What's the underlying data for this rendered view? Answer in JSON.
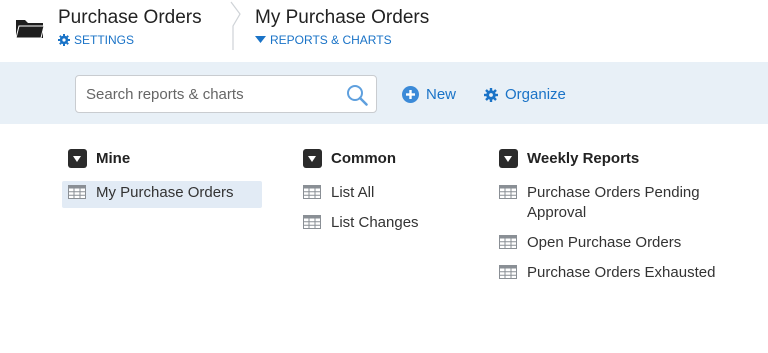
{
  "header": {
    "section_title": "Purchase Orders",
    "settings_label": "SETTINGS",
    "page_title": "My Purchase Orders",
    "reports_label": "REPORTS & CHARTS"
  },
  "toolbar": {
    "search_placeholder": "Search reports & charts",
    "new_label": "New",
    "organize_label": "Organize"
  },
  "groups": [
    {
      "title": "Mine",
      "items": [
        "My Purchase Orders"
      ],
      "selected": "My Purchase Orders"
    },
    {
      "title": "Common",
      "items": [
        "List All",
        "List Changes"
      ]
    },
    {
      "title": "Weekly Reports",
      "items": [
        "Purchase Orders Pending Approval",
        "Open Purchase Orders",
        "Purchase Orders Exhausted"
      ]
    }
  ],
  "colors": {
    "accent": "#1a73c7",
    "toolbar_bg": "#e8f0f7",
    "selected_bg": "#e2ebf5"
  },
  "icons": [
    "folder-icon",
    "gear-icon",
    "caret-down-icon",
    "search-icon",
    "plus-circle-icon",
    "chevron-down-icon",
    "table-icon"
  ]
}
